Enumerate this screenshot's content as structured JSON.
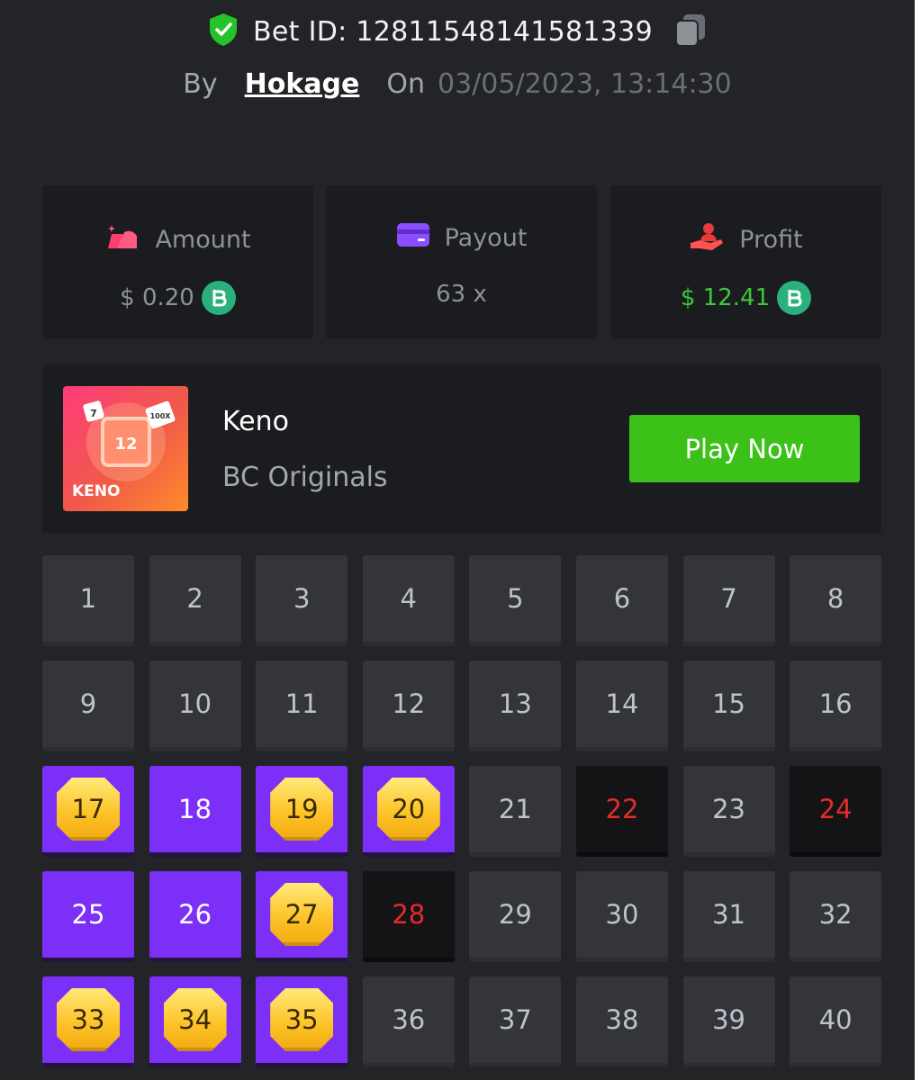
{
  "header": {
    "bet_id": "Bet ID: 128115481415813​39",
    "by_label": "By",
    "username": "Hokage",
    "on_label": "On",
    "date": "03/05/2023, 13:14:30"
  },
  "stats": [
    {
      "label": "Amount",
      "value": "$ 0.20",
      "icon": "money-bag-icon"
    },
    {
      "label": "Payout",
      "value": "63 x",
      "icon": "card-icon"
    },
    {
      "label": "Profit",
      "value": "$ 12.41",
      "icon": "hand-user-icon"
    }
  ],
  "game": {
    "name": "Keno",
    "provider": "BC Originals",
    "play_label": "Play Now",
    "thumb_number": "12",
    "thumb_title": "KENO",
    "thumb_badge_1": "7",
    "thumb_badge_2": "100X"
  },
  "colors": {
    "picked": "#7b2ff7",
    "hit_gem": "#fdc42a",
    "miss_text": "#e42b2b",
    "play_button": "#3bc117",
    "profit": "#3ec73a"
  },
  "keno_grid": [
    {
      "n": "1",
      "state": "normal"
    },
    {
      "n": "2",
      "state": "normal"
    },
    {
      "n": "3",
      "state": "normal"
    },
    {
      "n": "4",
      "state": "normal"
    },
    {
      "n": "5",
      "state": "normal"
    },
    {
      "n": "6",
      "state": "normal"
    },
    {
      "n": "7",
      "state": "normal"
    },
    {
      "n": "8",
      "state": "normal"
    },
    {
      "n": "9",
      "state": "normal"
    },
    {
      "n": "10",
      "state": "normal"
    },
    {
      "n": "11",
      "state": "normal"
    },
    {
      "n": "12",
      "state": "normal"
    },
    {
      "n": "13",
      "state": "normal"
    },
    {
      "n": "14",
      "state": "normal"
    },
    {
      "n": "15",
      "state": "normal"
    },
    {
      "n": "16",
      "state": "normal"
    },
    {
      "n": "17",
      "state": "hit"
    },
    {
      "n": "18",
      "state": "picked"
    },
    {
      "n": "19",
      "state": "hit"
    },
    {
      "n": "20",
      "state": "hit"
    },
    {
      "n": "21",
      "state": "normal"
    },
    {
      "n": "22",
      "state": "miss"
    },
    {
      "n": "23",
      "state": "normal"
    },
    {
      "n": "24",
      "state": "miss"
    },
    {
      "n": "25",
      "state": "picked"
    },
    {
      "n": "26",
      "state": "picked"
    },
    {
      "n": "27",
      "state": "hit"
    },
    {
      "n": "28",
      "state": "miss"
    },
    {
      "n": "29",
      "state": "normal"
    },
    {
      "n": "30",
      "state": "normal"
    },
    {
      "n": "31",
      "state": "normal"
    },
    {
      "n": "32",
      "state": "normal"
    },
    {
      "n": "33",
      "state": "hit"
    },
    {
      "n": "34",
      "state": "hit"
    },
    {
      "n": "35",
      "state": "hit"
    },
    {
      "n": "36",
      "state": "normal"
    },
    {
      "n": "37",
      "state": "normal"
    },
    {
      "n": "38",
      "state": "normal"
    },
    {
      "n": "39",
      "state": "normal"
    },
    {
      "n": "40",
      "state": "normal"
    }
  ]
}
